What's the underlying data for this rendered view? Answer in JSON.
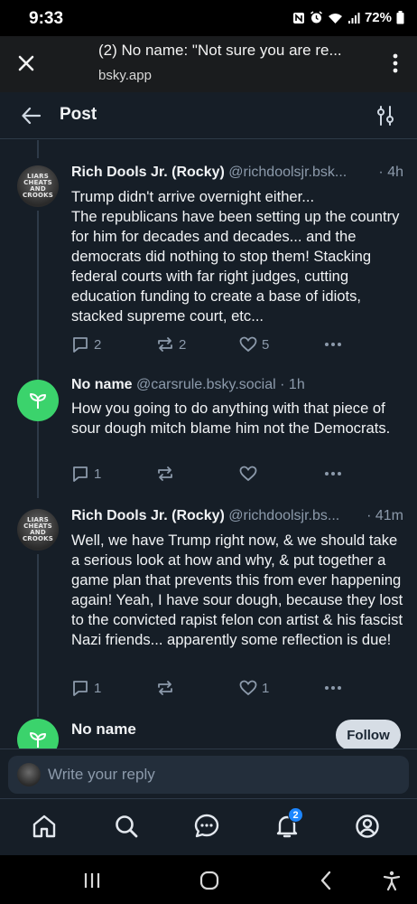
{
  "status_bar": {
    "time": "9:33",
    "battery": "72%"
  },
  "browser": {
    "title": "(2) No name: \"Not sure you are re...",
    "url": "bsky.app"
  },
  "header": {
    "title": "Post"
  },
  "posts": [
    {
      "author": "Rich Dools Jr. (Rocky)",
      "handle": "@richdoolsjr.bsk...",
      "time": "· 4h",
      "text": "Trump didn't arrive overnight either...\nThe republicans have been setting up the country for him for decades and decades... and the democrats did nothing to stop them! Stacking federal courts with far right judges, cutting education funding to create a base of idiots, stacked supreme court, etc...",
      "reply_count": "2",
      "repost_count": "2",
      "like_count": "5",
      "avatar_text": [
        "LIARS",
        "CHEATS",
        "AND",
        "CROOKS"
      ]
    },
    {
      "author": "No name",
      "handle": "@carsrule.bsky.social",
      "time": "· 1h",
      "text": "How you going to do anything with that piece of sour dough mitch blame him not the Democrats.",
      "reply_count": "1",
      "repost_count": "",
      "like_count": ""
    },
    {
      "author": "Rich Dools Jr. (Rocky)",
      "handle": "@richdoolsjr.bs...",
      "time": "· 41m",
      "text": "Well, we have Trump right now, & we should take a serious look at how and why, & put together a game plan that prevents this from ever happening again! Yeah, I have sour dough, because they lost to the convicted rapist felon con artist & his fascist Nazi friends... apparently some reflection is due!",
      "reply_count": "1",
      "repost_count": "",
      "like_count": "1",
      "avatar_text": [
        "LIARS",
        "CHEATS",
        "AND",
        "CROOKS"
      ]
    },
    {
      "author": "No name",
      "follow_label": "Follow"
    }
  ],
  "reply": {
    "placeholder": "Write your reply"
  },
  "nav": {
    "notifications_badge": "2",
    "icons": [
      "home-icon",
      "search-icon",
      "chat-icon",
      "bell-icon",
      "profile-icon"
    ]
  },
  "colors": {
    "background": "#161e27",
    "muted": "#8c9aab",
    "accent": "#1d86ff",
    "green_avatar": "#3bd36c"
  }
}
